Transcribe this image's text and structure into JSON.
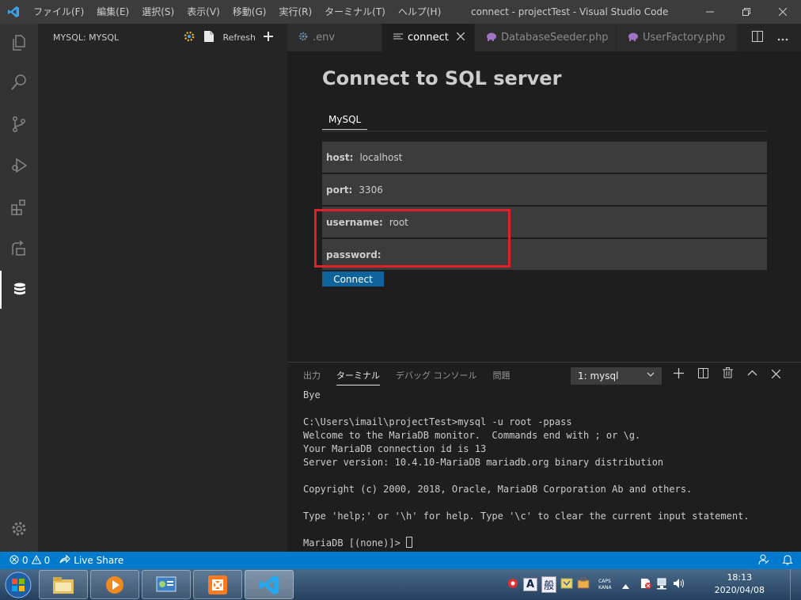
{
  "titlebar": {
    "menu": [
      "ファイル(F)",
      "編集(E)",
      "選択(S)",
      "表示(V)",
      "移動(G)",
      "実行(R)",
      "ターミナル(T)",
      "ヘルプ(H)"
    ],
    "title": "connect - projectTest - Visual Studio Code"
  },
  "sidebar": {
    "title": "MYSQL: MYSQL",
    "refresh_label": "Refresh"
  },
  "tabs": [
    {
      "label": ".env"
    },
    {
      "label": "connect"
    },
    {
      "label": "DatabaseSeeder.php"
    },
    {
      "label": "UserFactory.php"
    }
  ],
  "form": {
    "title": "Connect to SQL server",
    "db_tab": "MySQL",
    "fields": [
      {
        "label": "host:",
        "value": "localhost"
      },
      {
        "label": "port:",
        "value": "3306"
      },
      {
        "label": "username:",
        "value": "root"
      },
      {
        "label": "password:",
        "value": ""
      }
    ],
    "connect_label": "Connect",
    "highlight_color": "#e0202a"
  },
  "panel": {
    "tabs": [
      "出力",
      "ターミナル",
      "デバッグ コンソール",
      "問題"
    ],
    "active_tab": "ターミナル",
    "terminal_select": "1: mysql",
    "lines": [
      "Bye",
      "",
      "C:\\Users\\imail\\projectTest>mysql -u root -ppass",
      "Welcome to the MariaDB monitor.  Commands end with ; or \\g.",
      "Your MariaDB connection id is 13",
      "Server version: 10.4.10-MariaDB mariadb.org binary distribution",
      "",
      "Copyright (c) 2000, 2018, Oracle, MariaDB Corporation Ab and others.",
      "",
      "Type 'help;' or '\\h' for help. Type '\\c' to clear the current input statement.",
      ""
    ],
    "prompt": "MariaDB [(none)]> "
  },
  "statusbar": {
    "errors": "0",
    "warnings": "0",
    "live_share": "Live Share",
    "accent": "#007acc"
  },
  "taskbar": {
    "ime_mode": "A",
    "ime_kanji": "般",
    "caps": "CAPS",
    "kana": "KANA",
    "time": "18:13",
    "date": "2020/04/08"
  }
}
